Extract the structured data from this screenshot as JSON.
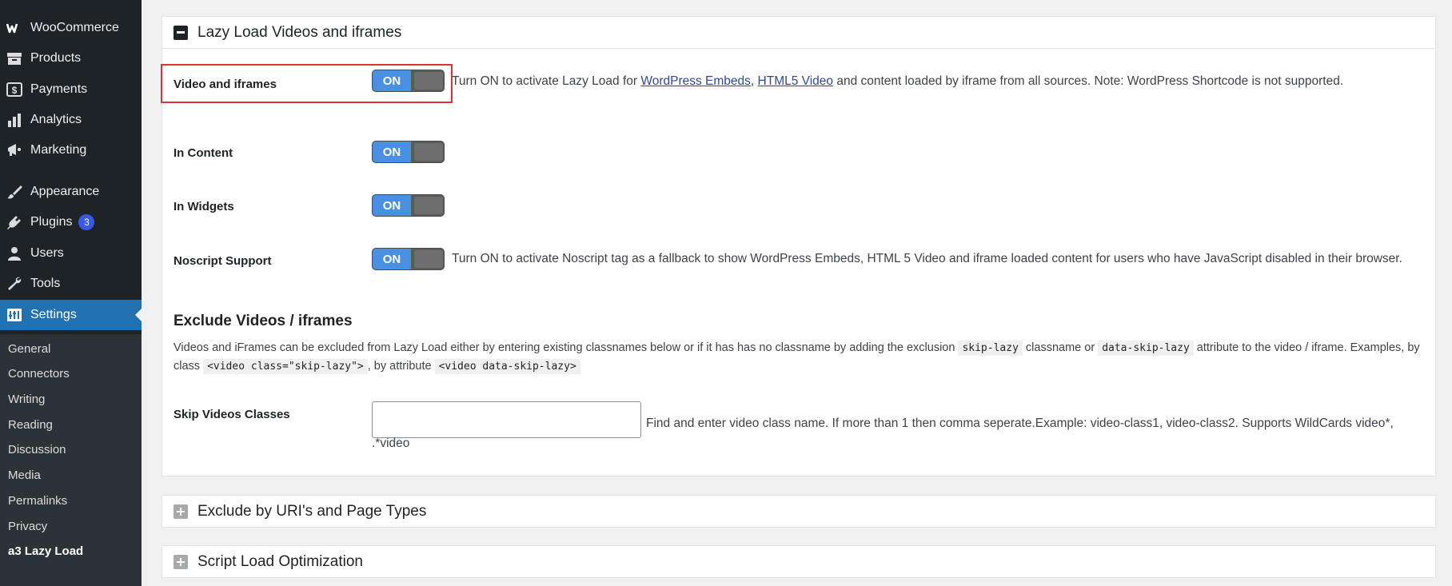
{
  "sidebar": {
    "items": [
      {
        "label": "WooCommerce",
        "icon": "woocommerce-icon"
      },
      {
        "label": "Products",
        "icon": "products-icon"
      },
      {
        "label": "Payments",
        "icon": "payments-icon"
      },
      {
        "label": "Analytics",
        "icon": "analytics-icon"
      },
      {
        "label": "Marketing",
        "icon": "marketing-icon"
      },
      {
        "label": "Appearance",
        "icon": "appearance-icon"
      },
      {
        "label": "Plugins",
        "icon": "plugins-icon",
        "badge": "3"
      },
      {
        "label": "Users",
        "icon": "users-icon"
      },
      {
        "label": "Tools",
        "icon": "tools-icon"
      },
      {
        "label": "Settings",
        "icon": "settings-icon"
      }
    ],
    "submenu": [
      "General",
      "Connectors",
      "Writing",
      "Reading",
      "Discussion",
      "Media",
      "Permalinks",
      "Privacy",
      "a3 Lazy Load"
    ]
  },
  "panel": {
    "title": "Lazy Load Videos and iframes",
    "rows": [
      {
        "label": "Video and iframes",
        "state": "ON"
      },
      {
        "label": "In Content",
        "state": "ON"
      },
      {
        "label": "In Widgets",
        "state": "ON"
      },
      {
        "label": "Noscript Support",
        "state": "ON"
      }
    ],
    "video_desc_prefix": "Turn ON to activate Lazy Load for ",
    "link_embeds": "WordPress Embeds",
    "comma": ",",
    "link_html5": "HTML5 Video",
    "video_desc_suffix": " and content loaded by iframe from all sources. Note: WordPress Shortcode is not supported.",
    "noscript_desc": "Turn ON to activate Noscript tag as a fallback to show WordPress Embeds, HTML 5 Video and iframe loaded content for users who have JavaScript disabled in their browser.",
    "exclude_title": "Exclude Videos / iframes",
    "exclude_p1": "Videos and iFrames can be excluded from Lazy Load either by entering existing classnames below or if it has has no classname by adding the exclusion ",
    "code_skip_lazy": "skip-lazy",
    "exclude_p2": " classname or ",
    "code_data_skip": "data-skip-lazy",
    "exclude_p3": " attribute to the video / iframe. Examples, by class ",
    "code_video_class": "<video class=\"skip-lazy\">",
    "exclude_p4": ", by attribute ",
    "code_video_data": "<video data-skip-lazy>",
    "skip_label": "Skip Videos Classes",
    "skip_value": "",
    "skip_desc": "Find and enter video class name. If more than 1 then comma seperate.Example: video-class1, video-class2. Supports WildCards video*,",
    "skip_desc2": ".*video"
  },
  "collapsed_panels": [
    {
      "title": "Exclude by URI's and Page Types"
    },
    {
      "title": "Script Load Optimization"
    }
  ],
  "colors": {
    "sidebar_bg": "#1d2327",
    "active_bg": "#2271b1",
    "switch_on": "#4a90e2",
    "highlight": "#d63638"
  }
}
